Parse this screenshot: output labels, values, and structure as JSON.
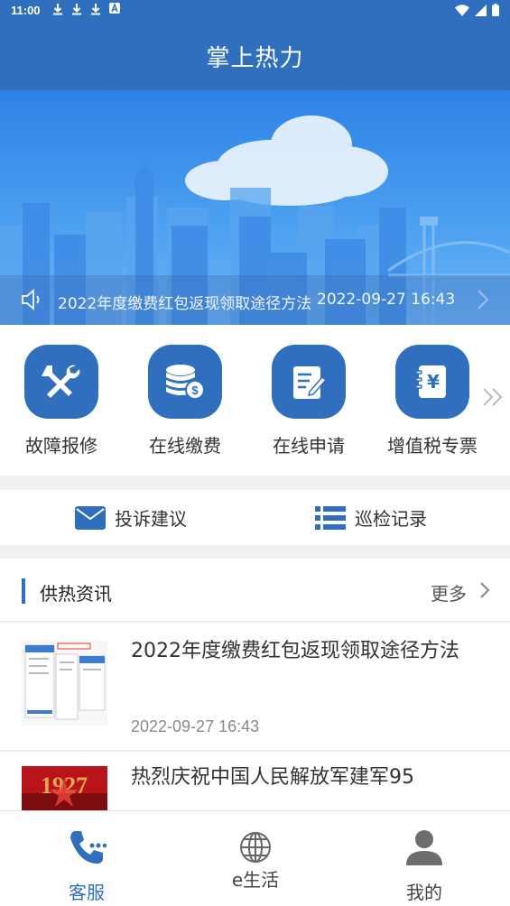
{
  "status_bar": {
    "time": "11:00",
    "download_icons": [
      "download-icon",
      "download-icon",
      "download-icon"
    ],
    "notification_icon": "a-icon",
    "right_icons": [
      "wifi-icon",
      "signal-icon",
      "battery-icon"
    ]
  },
  "header": {
    "title": "掌上热力"
  },
  "banner": {
    "notice_text": "2022年度缴费红包返现领取途径方法",
    "notice_date": "2022-09-27 16:43"
  },
  "quick_menu": {
    "items": [
      {
        "label": "故障报修",
        "icon": "repair-tools-icon"
      },
      {
        "label": "在线缴费",
        "icon": "coins-payment-icon"
      },
      {
        "label": "在线申请",
        "icon": "form-edit-icon"
      },
      {
        "label": "增值税专票",
        "icon": "yuan-invoice-icon"
      }
    ],
    "more_icon": "double-chevron-right-icon"
  },
  "secondary_menu": {
    "complaint_label": "投诉建议",
    "patrol_label": "巡检记录"
  },
  "news": {
    "section_title": "供热资讯",
    "more_label": "更多",
    "items": [
      {
        "title": "2022年度缴费红包返现领取途径方法",
        "date": "2022-09-27 16:43"
      },
      {
        "title": "热烈庆祝中国人民解放军建军95",
        "date": ""
      }
    ]
  },
  "tabbar": {
    "tabs": [
      {
        "label": "客服",
        "active": true,
        "icon": "phone-icon"
      },
      {
        "label": "e生活",
        "active": false,
        "icon": "globe-icon"
      },
      {
        "label": "我的",
        "active": false,
        "icon": "user-icon"
      }
    ]
  },
  "colors": {
    "primary": "#2f6fbd",
    "active_tab": "#2f6fbd",
    "inactive_tab": "#666666",
    "page_bg": "#f0f0f0"
  }
}
